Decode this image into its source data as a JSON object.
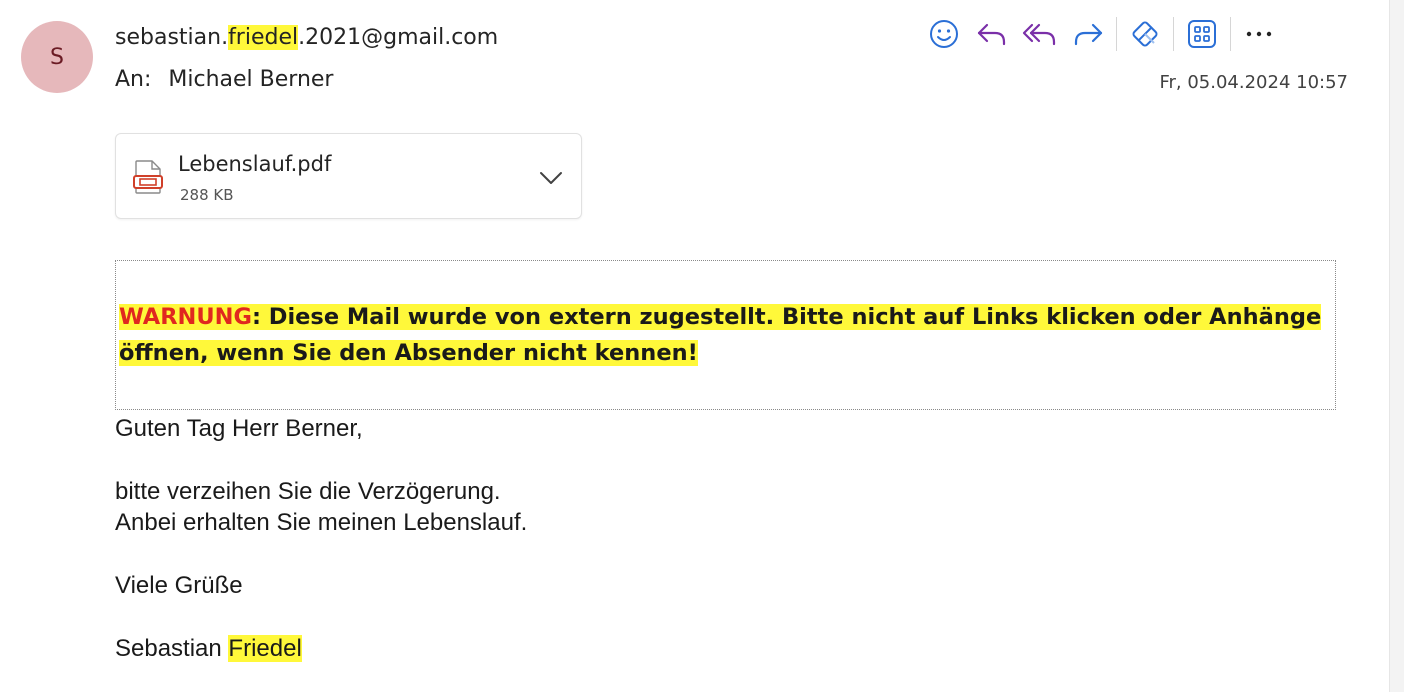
{
  "sender": {
    "avatar_initial": "S",
    "email_prefix": "sebastian.",
    "email_highlight": "friedel",
    "email_suffix": ".2021@gmail.com",
    "to_label": "An:",
    "to_name": "Michael Berner",
    "date": "Fr, 05.04.2024 10:57"
  },
  "toolbar": {
    "icons": [
      "emoji-icon",
      "reply-icon",
      "reply-all-icon",
      "forward-icon",
      "sticker-icon",
      "apps-grid-icon",
      "more-icon"
    ]
  },
  "attachment": {
    "name": "Lebenslauf.pdf",
    "size": "288 KB"
  },
  "warning": {
    "label": "WARNUNG",
    "text": ": Diese Mail wurde von extern zugestellt. Bitte nicht auf Links klicken oder Anhänge öffnen, wenn Sie den Absender nicht kennen!"
  },
  "body": {
    "greeting": "Guten Tag Herr Berner,",
    "line1": "bitte verzeihen Sie die Verzögerung.",
    "line2": "Anbei erhalten Sie meinen Lebenslauf.",
    "closing": "Viele Grüße",
    "signature_first": "Sebastian ",
    "signature_last": "Friedel"
  },
  "colors": {
    "accent": "#2b6fd6",
    "reply_purple": "#7a2fa8",
    "highlight": "#fff83a",
    "warning_red": "#e0281f",
    "avatar_bg": "#e6b8bb"
  }
}
